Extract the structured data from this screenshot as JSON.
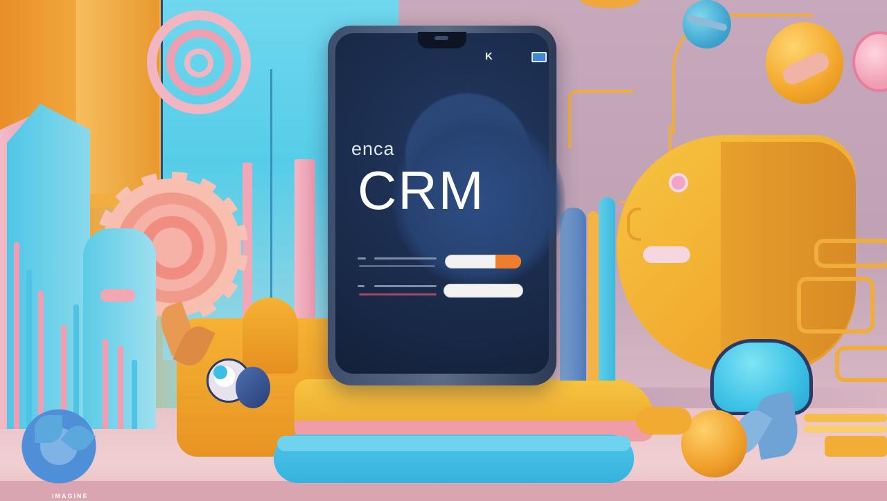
{
  "phone": {
    "status": {
      "icon_left": "K",
      "battery_icon": "battery-icon"
    },
    "brand_text": "enca",
    "title_text": "CRM",
    "fields": [
      {
        "label": "",
        "placeholder": "",
        "accent": "orange"
      },
      {
        "label": "",
        "placeholder": "",
        "accent": "white"
      }
    ]
  },
  "colors": {
    "screen_navy": "#1f3358",
    "accent_orange": "#f07d2c",
    "scene_yellow": "#f7c442",
    "scene_cyan": "#4ec5e8",
    "scene_pink": "#f2b6c2"
  },
  "watermark_text": "IMAGINE"
}
